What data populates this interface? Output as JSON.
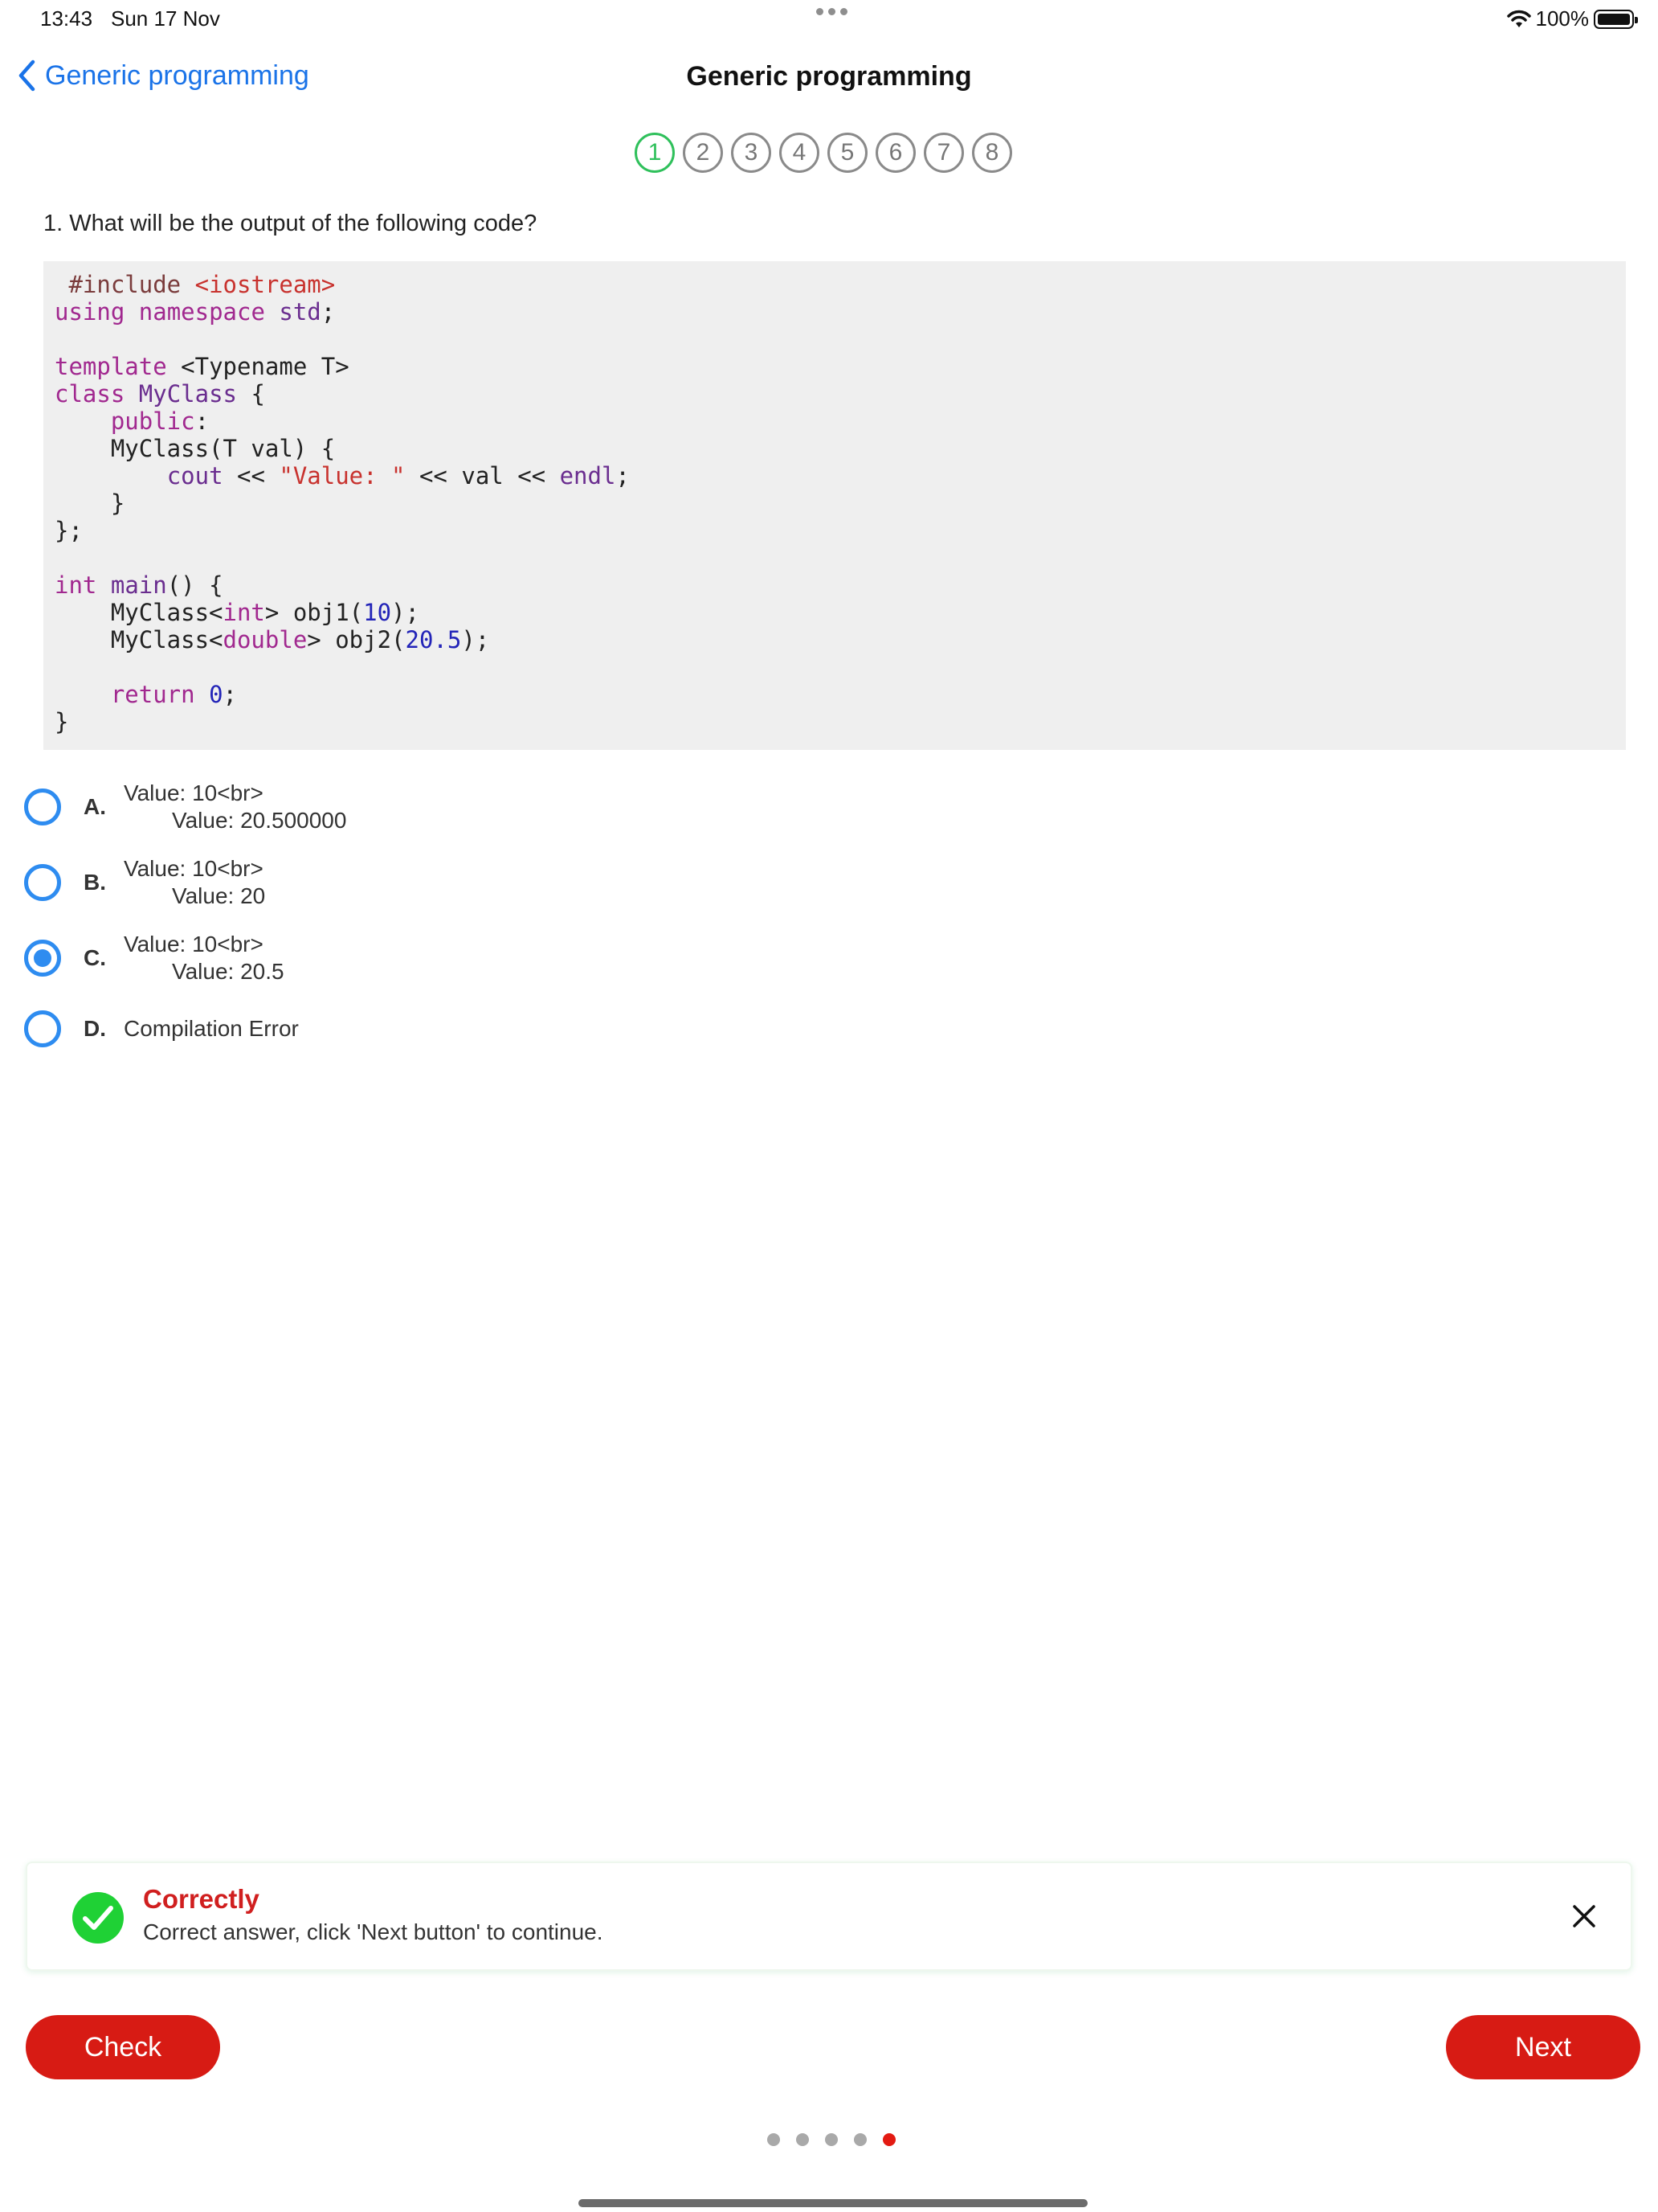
{
  "status_bar": {
    "time": "13:43",
    "date": "Sun 17 Nov",
    "battery": "100%"
  },
  "nav": {
    "back_label": "Generic programming",
    "title": "Generic programming"
  },
  "steps": [
    "1",
    "2",
    "3",
    "4",
    "5",
    "6",
    "7",
    "8"
  ],
  "question": {
    "text": "1. What will be the output of the following code?"
  },
  "options": [
    {
      "letter": "A.",
      "line1": "Value: 10<br>",
      "line2": "Value: 20.500000"
    },
    {
      "letter": "B.",
      "line1": "Value: 10<br>",
      "line2": "Value: 20"
    },
    {
      "letter": "C.",
      "line1": "Value: 10<br>",
      "line2": "Value: 20.5"
    },
    {
      "letter": "D.",
      "line1": "Compilation Error"
    }
  ],
  "feedback": {
    "title": "Correctly",
    "message": "Correct answer, click 'Next button' to continue."
  },
  "buttons": {
    "check": "Check",
    "next": "Next"
  },
  "colors": {
    "accent": "#1a73e8",
    "primary_button": "#d71b14",
    "success": "#1fd135",
    "active_step": "#2fc05b"
  }
}
